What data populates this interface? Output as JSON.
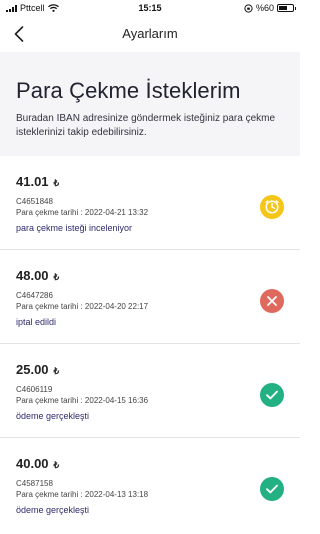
{
  "status_bar": {
    "carrier": "Pttcell",
    "time": "15:15",
    "battery": "%60"
  },
  "nav": {
    "title": "Ayarlarım"
  },
  "header": {
    "title": "Para Çekme İsteklerim",
    "description": "Buradan IBAN adresinize göndermek isteğiniz para çekme isteklerinizi takip edebilirsiniz."
  },
  "colors": {
    "pending": "#f5c518",
    "cancelled": "#e0695e",
    "done": "#23b083",
    "status_text": "#2f2a6b"
  },
  "requests": [
    {
      "amount": "41.01",
      "currency": "₺",
      "code": "C4651848",
      "date_label": "Para çekme tarihi : 2022-04-21 13:32",
      "status": "para çekme isteği inceleniyor",
      "icon": "clock-icon"
    },
    {
      "amount": "48.00",
      "currency": "₺",
      "code": "C4647286",
      "date_label": "Para çekme tarihi : 2022-04-20 22:17",
      "status": "iptal edildi",
      "icon": "close-icon"
    },
    {
      "amount": "25.00",
      "currency": "₺",
      "code": "C4606119",
      "date_label": "Para çekme tarihi : 2022-04-15 16:36",
      "status": "ödeme gerçekleşti",
      "icon": "check-icon"
    },
    {
      "amount": "40.00",
      "currency": "₺",
      "code": "C4587158",
      "date_label": "Para çekme tarihi : 2022-04-13 13:18",
      "status": "ödeme gerçekleşti",
      "icon": "check-icon"
    }
  ]
}
